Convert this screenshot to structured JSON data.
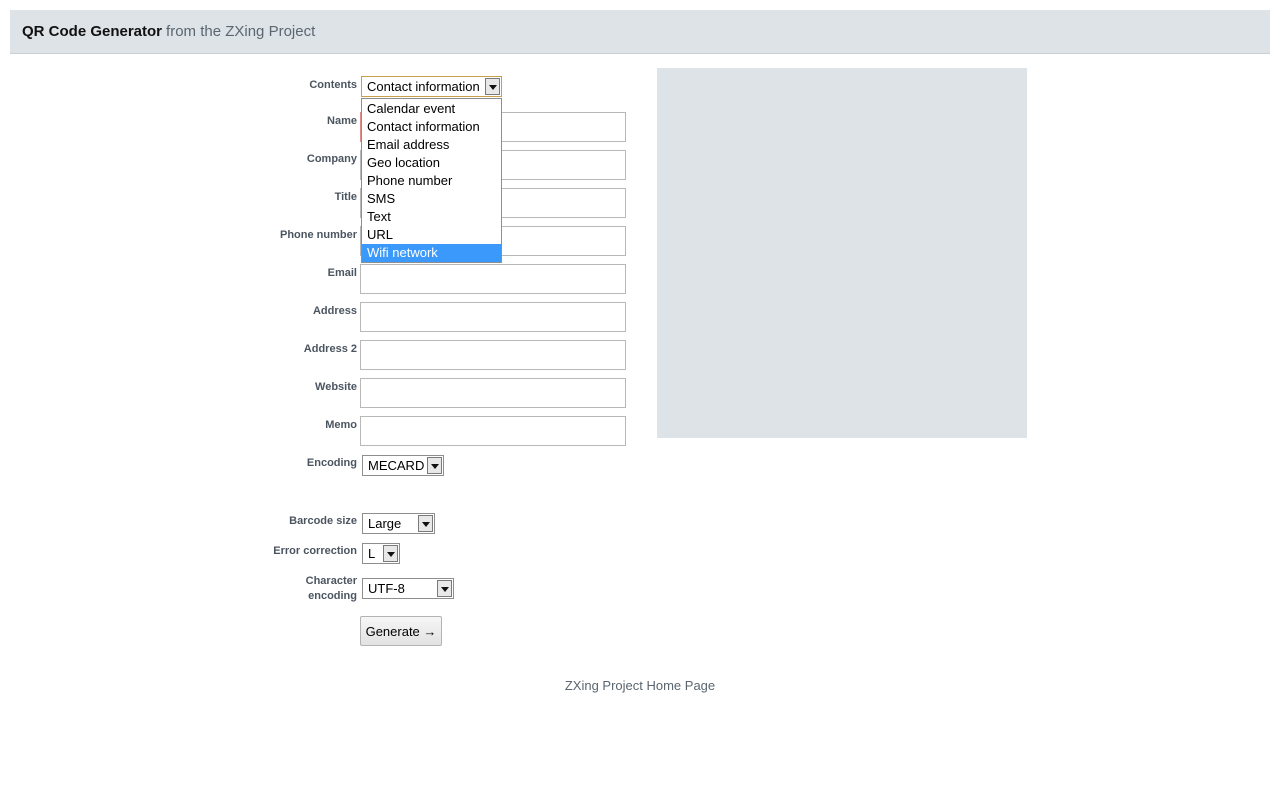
{
  "header": {
    "title": "QR Code Generator",
    "subtitle": "from the ZXing Project"
  },
  "form": {
    "contents": {
      "label": "Contents",
      "selected": "Contact information",
      "options": [
        "Calendar event",
        "Contact information",
        "Email address",
        "Geo location",
        "Phone number",
        "SMS",
        "Text",
        "URL",
        "Wifi network"
      ],
      "highlighted": "Wifi network"
    },
    "fields": {
      "name": "Name",
      "company": "Company",
      "title": "Title",
      "phone": "Phone number",
      "email": "Email",
      "address": "Address",
      "address2": "Address 2",
      "website": "Website",
      "memo": "Memo"
    },
    "encoding": {
      "label": "Encoding",
      "value": "MECARD"
    },
    "barcode_size": {
      "label": "Barcode size",
      "value": "Large"
    },
    "error_correction": {
      "label": "Error correction",
      "value": "L"
    },
    "character_encoding": {
      "label_line1": "Character",
      "label_line2": "encoding",
      "value": "UTF-8"
    },
    "generate_label": "Generate →"
  },
  "footer": {
    "link": "ZXing Project Home Page"
  },
  "colors": {
    "header_bg": "#dee3e8",
    "preview_bg": "#dee3e8",
    "highlight": "#3b99fc",
    "label": "#4b5560"
  }
}
